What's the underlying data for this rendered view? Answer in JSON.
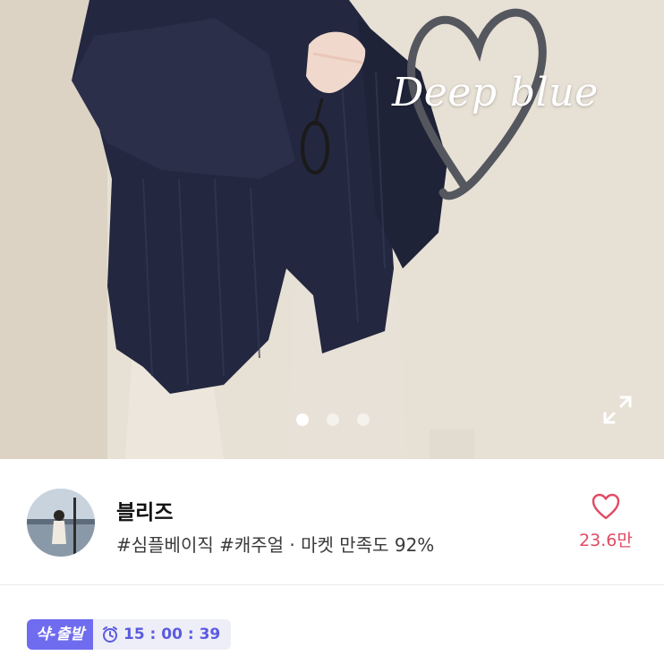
{
  "hero": {
    "caption": "Deep blue",
    "slide_count": 3,
    "active_slide": 1
  },
  "seller": {
    "name": "블리즈",
    "tags": "#심플베이직 #캐주얼 · 마켓 만족도 92%",
    "like_count": "23.6만"
  },
  "shipping": {
    "badge": "샥-출발",
    "countdown": "15 : 00 : 39"
  },
  "colors": {
    "accent": "#6f6cf0",
    "like": "#e14a64",
    "garment": "#23273f"
  }
}
